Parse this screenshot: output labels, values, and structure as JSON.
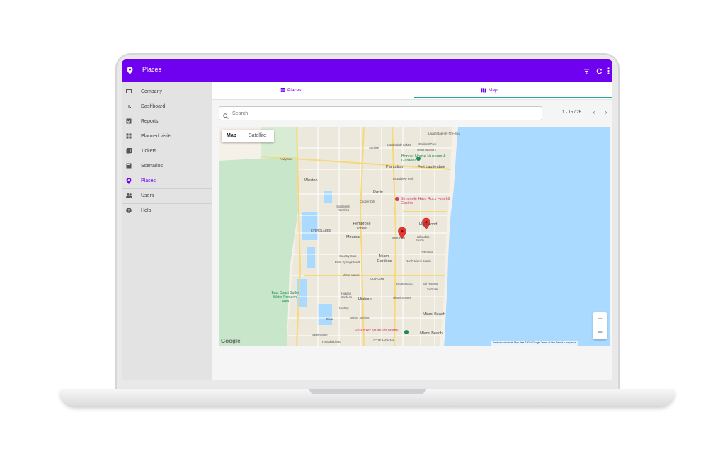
{
  "app": {
    "title": "Places"
  },
  "sidebar": {
    "items": [
      {
        "label": "Company",
        "icon": "card-icon"
      },
      {
        "label": "Dashboard",
        "icon": "chart-icon"
      },
      {
        "label": "Reports",
        "icon": "checkbox-icon"
      },
      {
        "label": "Planned visits",
        "icon": "grid-icon"
      },
      {
        "label": "Tickets",
        "icon": "ticket-icon"
      },
      {
        "label": "Scenarios",
        "icon": "scenario-icon"
      },
      {
        "label": "Places",
        "icon": "pin-icon"
      },
      {
        "label": "Users",
        "icon": "users-icon"
      },
      {
        "label": "Help",
        "icon": "help-icon"
      }
    ],
    "active": "Places"
  },
  "tabs": [
    {
      "label": "Places",
      "icon": "list-icon"
    },
    {
      "label": "Map",
      "icon": "map-icon",
      "active": true
    }
  ],
  "search": {
    "placeholder": "Search"
  },
  "pagination": {
    "range": "1 - 15 / 26"
  },
  "map": {
    "type_buttons": {
      "map": "Map",
      "satellite": "Satellite"
    },
    "zoom_in": "+",
    "zoom_out": "−",
    "google": "Google",
    "attribution": "Keyboard shortcuts    Map data ©2021 Google    Terms of Use    Report a map error",
    "labels": {
      "lauderdale_by_the_sea": "Lauderdale-By-The-Sea",
      "oakland_park": "Oakland Park",
      "sunrise": "Sunrise",
      "lauderdale_lakes": "Lauderdale Lakes",
      "wilton_manors": "Wilton Manors",
      "bonnet_house": "Bonnet House Museum & Gardens",
      "plantation": "Plantation",
      "fort_lauderdale": "Fort Lauderdale",
      "andytown": "Andytown",
      "weston": "Weston",
      "broadview_park": "Broadview Park",
      "davie": "Davie",
      "seminole": "Seminole Hard Rock Hotel & Casino",
      "cooper_city": "Cooper City",
      "southwest_ranches": "Southwest Ranches",
      "pembroke_pines": "Pembroke Pines",
      "hollywood": "Hollywood",
      "miramar": "Miramar",
      "west_park": "West Park",
      "hallandale": "Hallandale Beach",
      "everglades": "EVERGLADES",
      "country_club": "Country Club",
      "miami_gardens": "Miami Gardens",
      "aventura": "Aventura",
      "palm_springs_north": "Palm Springs North",
      "north_miami_beach": "North Miami Beach",
      "miami_lakes": "Miami Lakes",
      "opa_locka": "Opa-locka",
      "north_miami": "North Miami",
      "bal_harbour": "Bal Harbour",
      "surfside": "Surfside",
      "east_coast_buffer": "East Coast Buffer Water Preserve Area",
      "hialeah_gardens": "Hialeah Gardens",
      "hialeah": "Hialeah",
      "miami_shores": "Miami Shores",
      "medley": "Medley",
      "doral": "Doral",
      "miami_springs": "Miami Springs",
      "miami_beach": "Miami Beach",
      "perez": "Pérez Art Museum Miami",
      "sweetwater": "Sweetwater",
      "fontainebleau": "Fontainebleau",
      "little_havana": "LITTLE HAVANA"
    }
  },
  "colors": {
    "brand": "#6f00f0",
    "tab_indicator": "#26a69a",
    "marker": "#e53935",
    "water": "#aadaff"
  }
}
